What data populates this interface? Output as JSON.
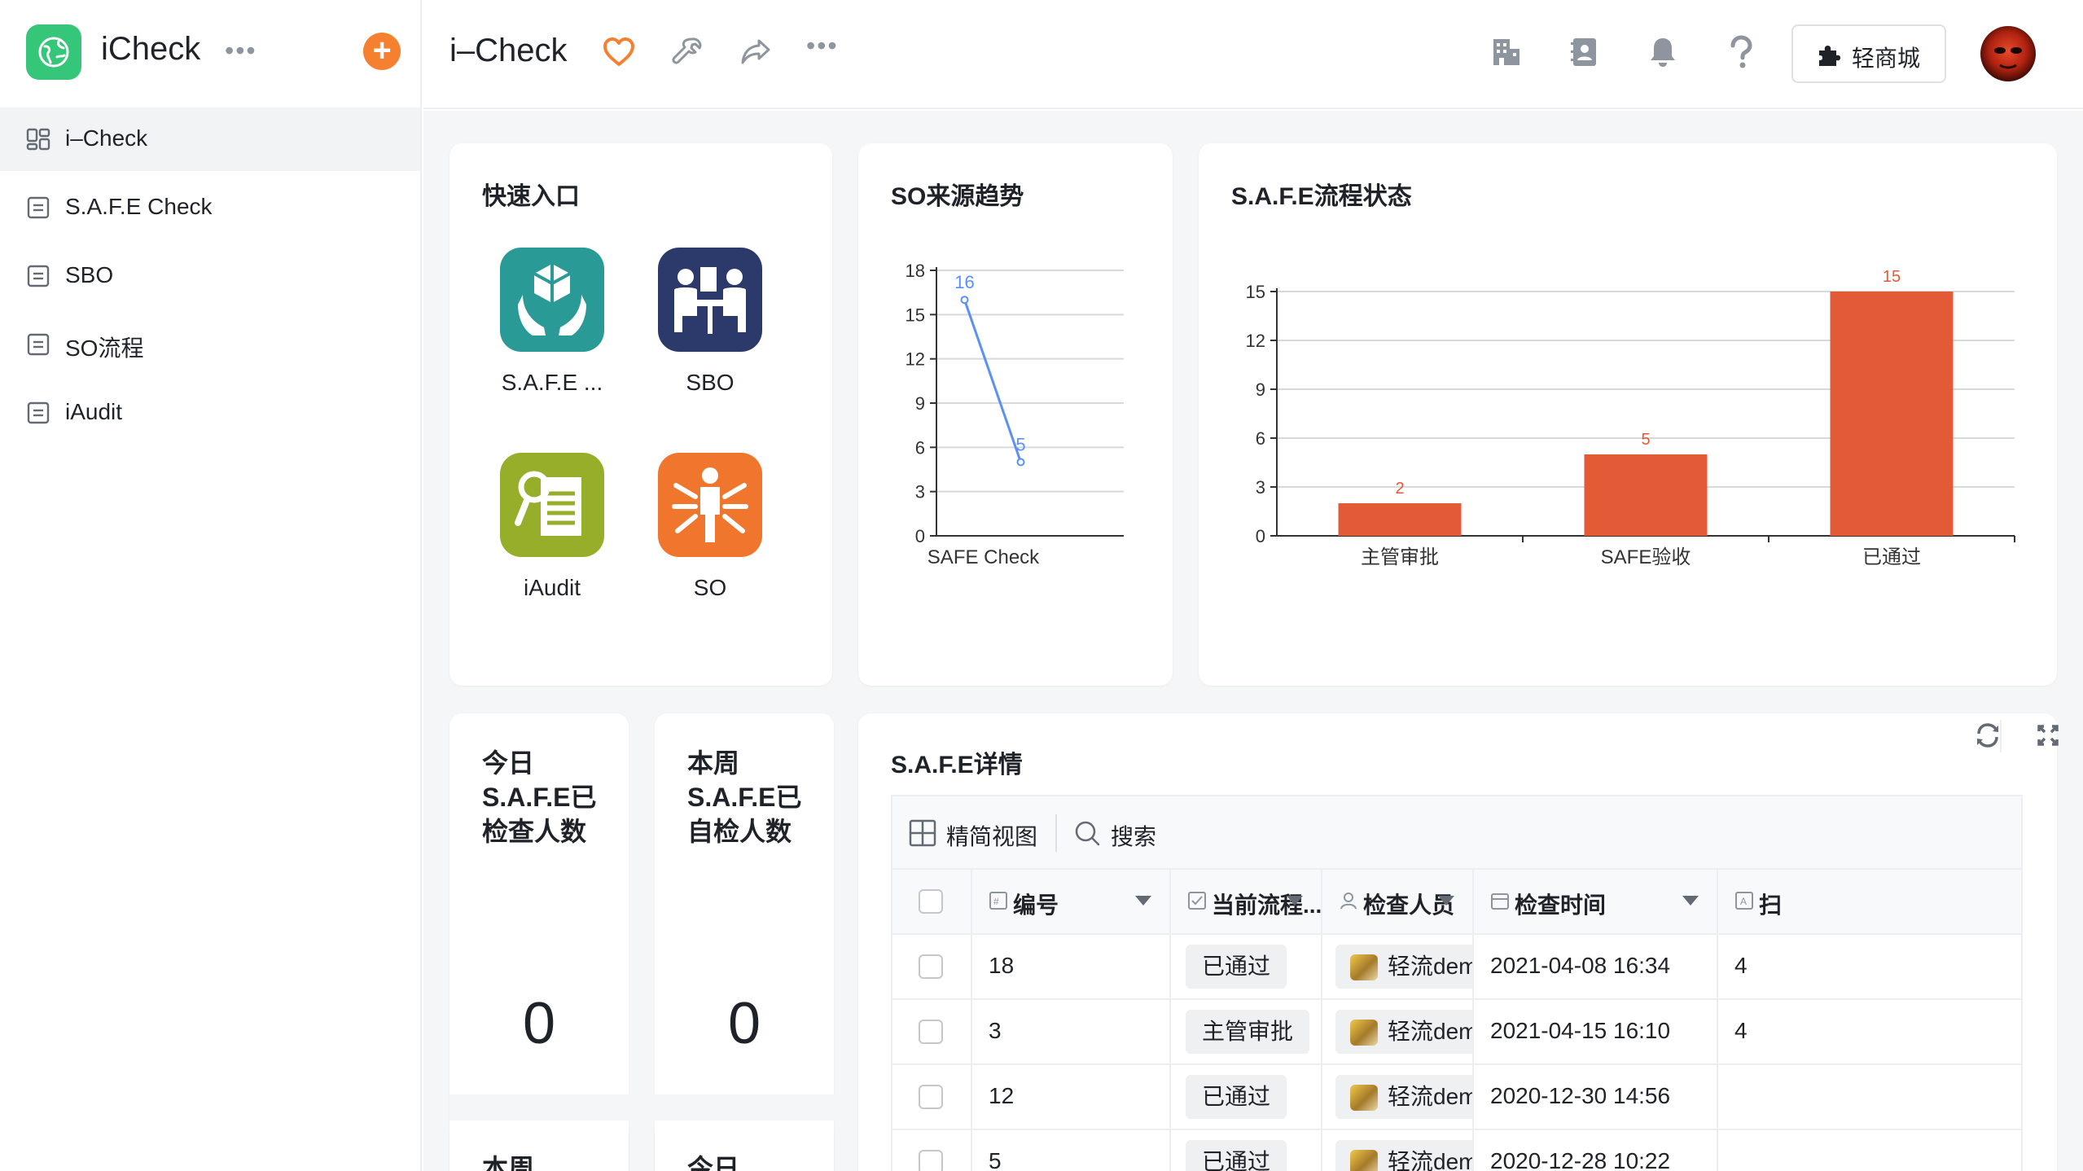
{
  "app": {
    "name": "iCheck",
    "more": "•••"
  },
  "sidebar": {
    "items": [
      {
        "label": "i–Check",
        "icon": "dashboard-icon"
      },
      {
        "label": "S.A.F.E Check",
        "icon": "form-icon"
      },
      {
        "label": "SBO",
        "icon": "form-icon"
      },
      {
        "label": "SO流程",
        "icon": "form-icon"
      },
      {
        "label": "iAudit",
        "icon": "form-icon"
      }
    ]
  },
  "header": {
    "title": "i–Check",
    "mall_button": "轻商城",
    "more": "•••"
  },
  "quick_entry": {
    "title": "快速入口",
    "items": [
      {
        "label": "S.A.F.E ...",
        "icon": "safe-hands-icon",
        "color": "#2a9a96"
      },
      {
        "label": "SBO",
        "icon": "meeting-icon",
        "color": "#2b3a6b"
      },
      {
        "label": "iAudit",
        "icon": "audit-icon",
        "color": "#97ae2a"
      },
      {
        "label": "SO",
        "icon": "so-person-icon",
        "color": "#f0762e"
      }
    ]
  },
  "so_trend": {
    "title": "SO来源趋势",
    "chart_data": {
      "type": "line",
      "title": "SO来源趋势",
      "x": [
        "",
        "SAFE Check",
        ""
      ],
      "series": [
        {
          "values": [
            16,
            5
          ]
        }
      ],
      "point_labels": [
        "16",
        "5"
      ],
      "x_tick_label": "SAFE Check",
      "yticks": [
        0,
        3,
        6,
        9,
        12,
        15,
        18
      ],
      "ylim": [
        0,
        18
      ],
      "grid": true,
      "color": "#5b8ff9"
    }
  },
  "safe_status": {
    "title": "S.A.F.E流程状态",
    "chart_data": {
      "type": "bar",
      "title": "S.A.F.E流程状态",
      "categories": [
        "主管审批",
        "SAFE验收",
        "已通过"
      ],
      "values": [
        2,
        5,
        15
      ],
      "yticks": [
        0,
        3,
        6,
        9,
        12,
        15
      ],
      "ylim": [
        0,
        15
      ],
      "grid": true,
      "color": "#e35a37"
    }
  },
  "stats": [
    {
      "title": "今日S.A.F.E已检查人数",
      "value": "0"
    },
    {
      "title": "本周S.A.F.E已自检人数",
      "value": "0"
    }
  ],
  "stats_next": [
    {
      "title": "本周"
    },
    {
      "title": "今日"
    }
  ],
  "safe_detail": {
    "title": "S.A.F.E详情",
    "toolbar": {
      "view": "精简视图",
      "search": "搜索"
    },
    "columns": [
      "编号",
      "当前流程...",
      "检查人员",
      "检查时间",
      "扫"
    ],
    "rows": [
      {
        "id": "18",
        "status": "已通过",
        "person": "轻流demo账号",
        "time": "2021-04-08 16:34",
        "extra": "4"
      },
      {
        "id": "3",
        "status": "主管审批",
        "person": "轻流demo账号",
        "time": "2021-04-15 16:10",
        "extra": "4"
      },
      {
        "id": "12",
        "status": "已通过",
        "person": "轻流demo账号",
        "time": "2020-12-30 14:56",
        "extra": ""
      },
      {
        "id": "5",
        "status": "已通过",
        "person": "轻流demo账号",
        "time": "2020-12-28 10:22",
        "extra": ""
      }
    ]
  }
}
